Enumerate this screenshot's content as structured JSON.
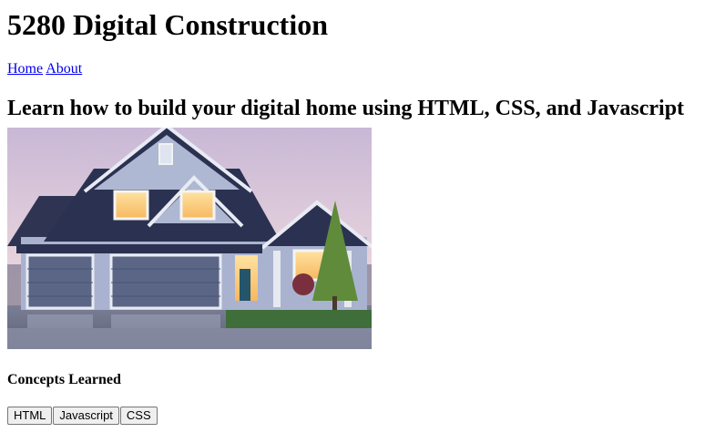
{
  "site": {
    "title": "5280 Digital Construction"
  },
  "nav": {
    "links": [
      {
        "label": "Home"
      },
      {
        "label": "About"
      }
    ]
  },
  "hero": {
    "heading": "Learn how to build your digital home using HTML, CSS, and Javascript"
  },
  "concepts": {
    "heading": "Concepts Learned",
    "buttons": [
      {
        "label": "HTML"
      },
      {
        "label": "Javascript"
      },
      {
        "label": "CSS"
      }
    ]
  }
}
